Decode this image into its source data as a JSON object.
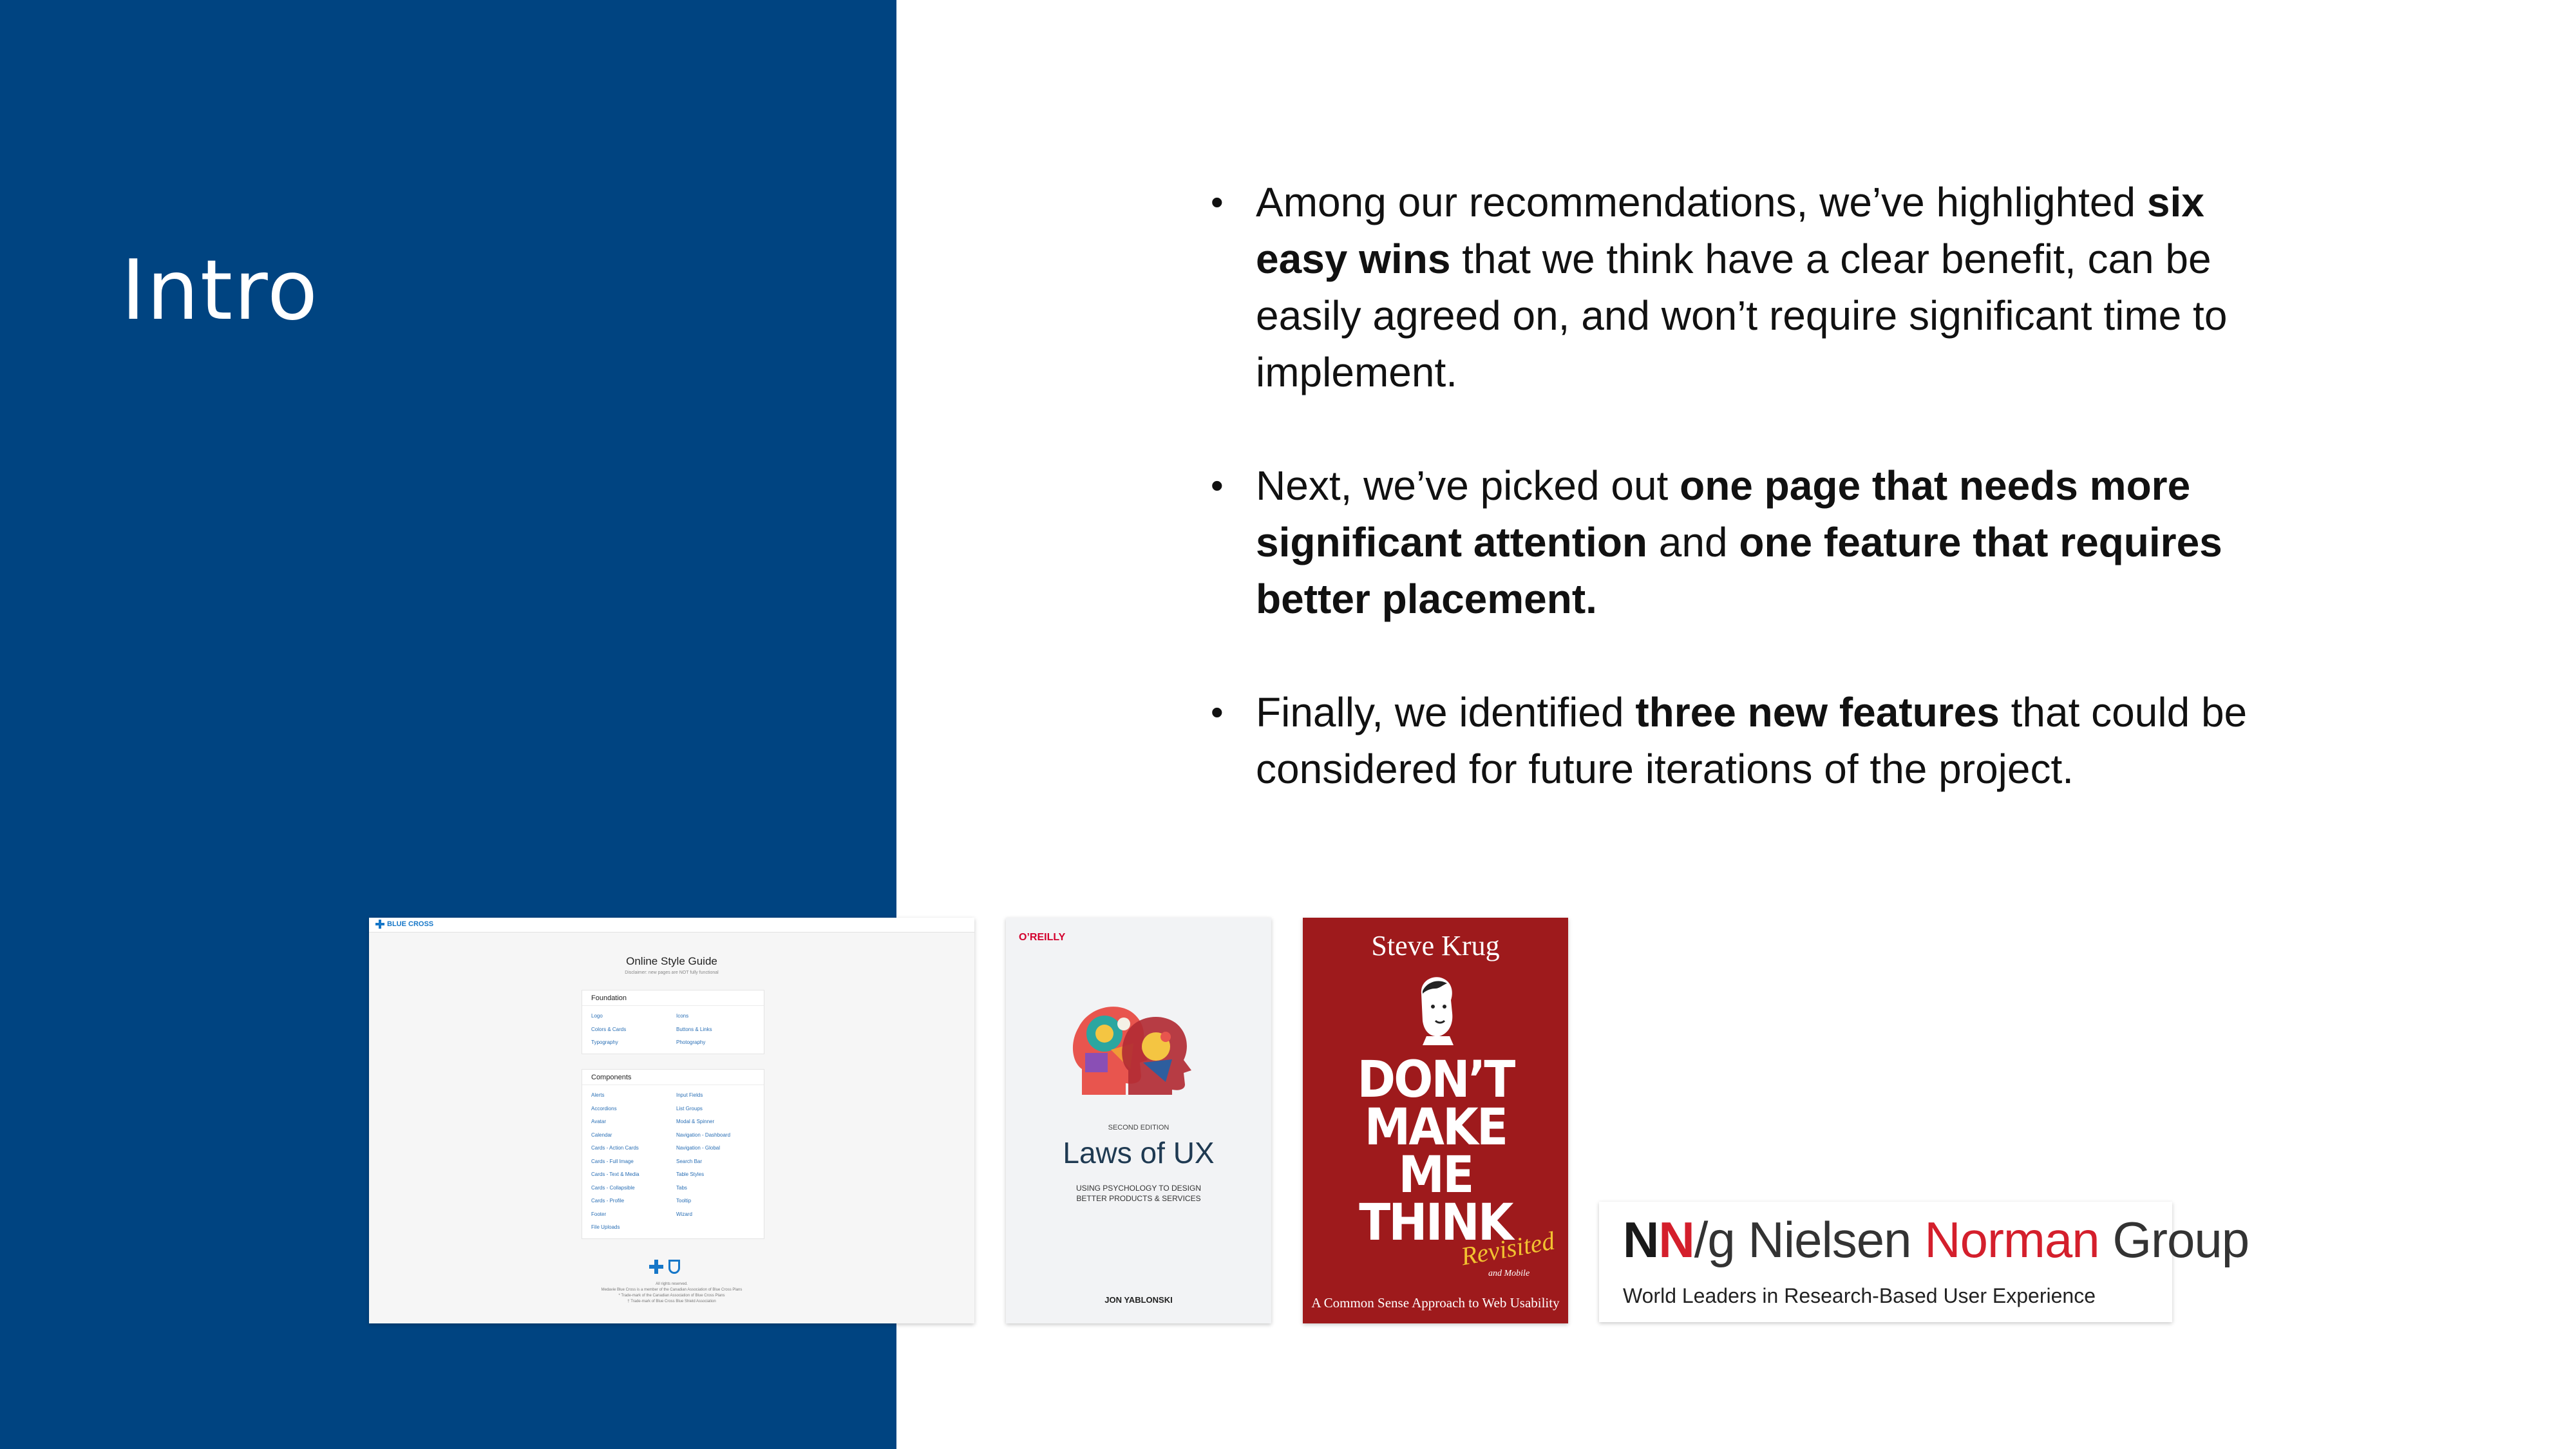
{
  "slide": {
    "title": "Intro",
    "colors": {
      "panel": "#004481",
      "text": "#111111",
      "accent_red": "#d41f2c"
    },
    "bullets": [
      {
        "pre": "Among our recommendations, we’ve highlighted ",
        "bold": "six easy wins",
        "post": " that we think have a clear benefit, can be easily agreed on, and won’t require significant time to implement."
      },
      {
        "pre": "Next, we’ve picked out ",
        "bold": "one page that needs more significant attention",
        "mid": " and ",
        "bold2": "one feature that requires better placement."
      },
      {
        "pre": "Finally, we identified ",
        "bold": "three new features",
        "post": " that could be considered for future iterations of the project."
      }
    ]
  },
  "style_guide": {
    "logo": "BLUE CROSS",
    "title": "Online Style Guide",
    "subtitle": "Disclaimer: new pages are NOT fully functional",
    "foundation": {
      "heading": "Foundation",
      "items": [
        "Logo",
        "Icons",
        "Colors & Cards",
        "Buttons & Links",
        "Typography",
        "Photography"
      ]
    },
    "components": {
      "heading": "Components",
      "items": [
        "Alerts",
        "Input Fields",
        "Accordions",
        "List Groups",
        "Avatar",
        "Modal & Spinner",
        "Calendar",
        "Navigation - Dashboard",
        "Cards - Action Cards",
        "Navigation - Global",
        "Cards - Full Image",
        "Search Bar",
        "Cards - Text & Media",
        "Table Styles",
        "Cards - Collapsible",
        "Tabs",
        "Cards - Profile",
        "Tooltip",
        "Footer",
        "Wizard",
        "File Uploads",
        ""
      ]
    },
    "footer": [
      "All rights reserved.",
      "Medavie Blue Cross is a member of the Canadian Association of Blue Cross Plans",
      "* Trade-mark of the Canadian Association of Blue Cross Plans",
      "† Trade-mark of Blue Cross Blue Shield Association"
    ]
  },
  "laws_of_ux": {
    "publisher": "O’REILLY",
    "edition": "SECOND EDITION",
    "title": "Laws of UX",
    "tagline": "USING PSYCHOLOGY TO DESIGN\nBETTER PRODUCTS & SERVICES",
    "author": "JON YABLONSKI"
  },
  "dont_make_me_think": {
    "author": "Steve Krug",
    "title": "DON’T\nMAKE\nME\nTHINK",
    "revisited": "Revisited",
    "subtitle": "A Common Sense Approach to Web Usability",
    "insert": "and Mobile"
  },
  "nng": {
    "n1": "N",
    "n2": "N",
    "slash": "/g",
    "name1": "Nielsen",
    "name2": "Norman",
    "name3": "Group",
    "tagline": "World Leaders in Research-Based User Experience"
  }
}
